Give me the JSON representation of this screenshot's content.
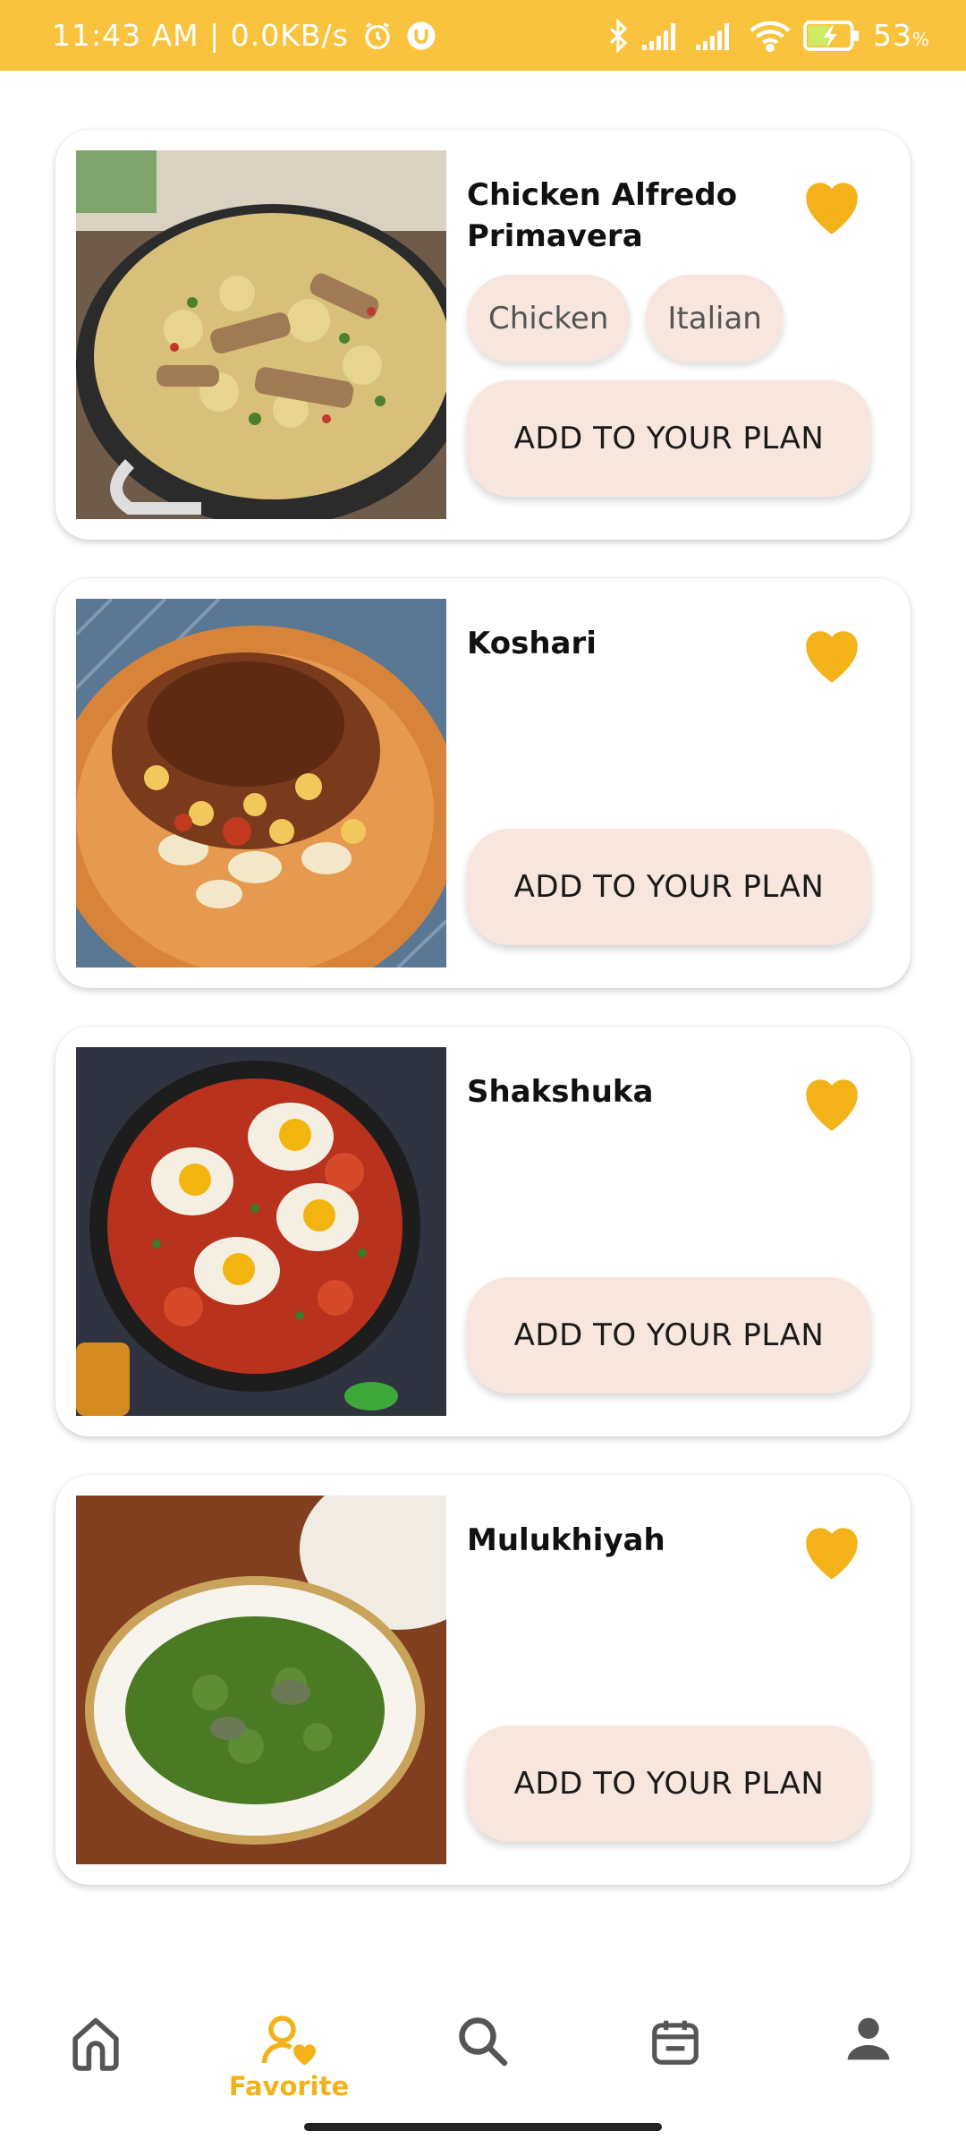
{
  "status_bar": {
    "time_speed": "11:43 AM | 0.0KB/s",
    "battery": "53",
    "battery_unit": "%"
  },
  "recipes": [
    {
      "title": "Chicken Alfredo Primavera",
      "tags": [
        "Chicken",
        "Italian"
      ],
      "button": "ADD TO YOUR PLAN",
      "favorite": true
    },
    {
      "title": "Koshari",
      "tags": [],
      "button": "ADD TO YOUR PLAN",
      "favorite": true
    },
    {
      "title": "Shakshuka",
      "tags": [],
      "button": "ADD TO YOUR PLAN",
      "favorite": true
    },
    {
      "title": "Mulukhiyah",
      "tags": [],
      "button": "ADD TO YOUR PLAN",
      "favorite": true
    }
  ],
  "nav": {
    "active_label": "Favorite",
    "items": [
      "home-icon",
      "favorite-icon",
      "search-icon",
      "calendar-icon",
      "profile-icon"
    ]
  },
  "colors": {
    "accent": "#F4B21A",
    "status_bar": "#F9C33E",
    "chip_bg": "#F7E6DE",
    "nav_icon": "#555555"
  }
}
